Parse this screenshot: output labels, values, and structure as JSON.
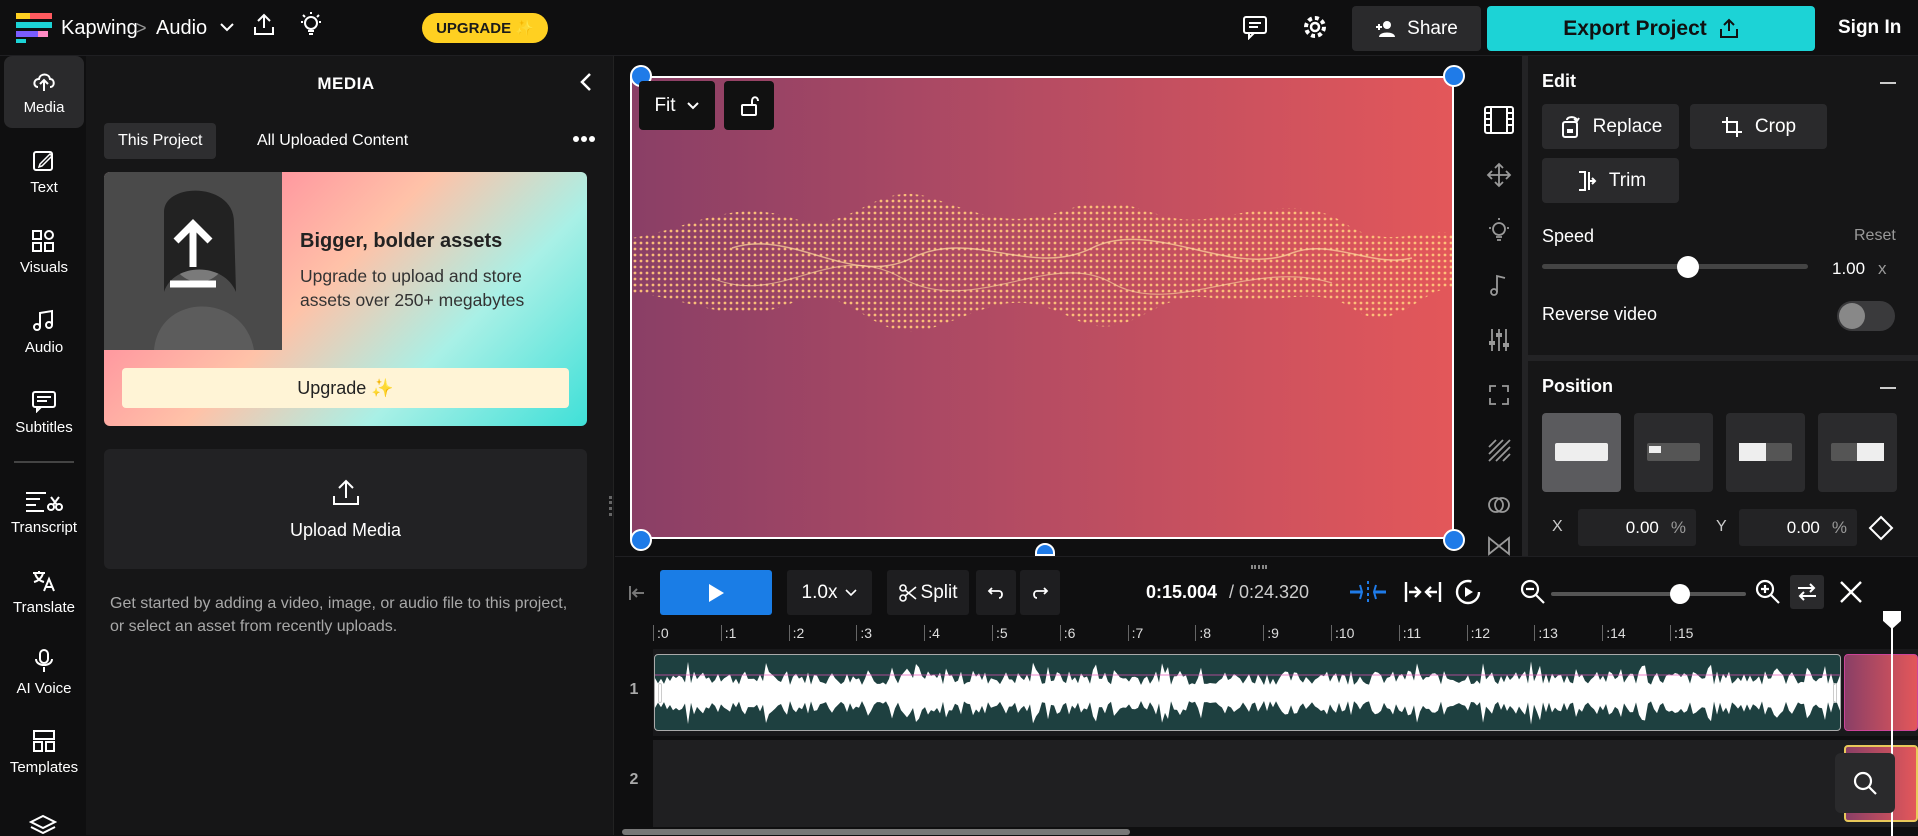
{
  "topbar": {
    "brand": "Kapwing",
    "breadcrumb_sep": ">",
    "project_name": "Audio",
    "upgrade_label": "UPGRADE ✨",
    "share_label": "Share",
    "export_label": "Export Project",
    "signin_label": "Sign In"
  },
  "leftnav": {
    "items": [
      {
        "label": "Media",
        "icon": "upload-cloud-icon"
      },
      {
        "label": "Text",
        "icon": "text-edit-icon"
      },
      {
        "label": "Visuals",
        "icon": "shapes-icon"
      },
      {
        "label": "Audio",
        "icon": "music-note-icon"
      },
      {
        "label": "Subtitles",
        "icon": "subtitles-icon"
      },
      {
        "label": "Transcript",
        "icon": "transcript-icon"
      },
      {
        "label": "Translate",
        "icon": "translate-icon"
      },
      {
        "label": "AI Voice",
        "icon": "microphone-icon"
      },
      {
        "label": "Templates",
        "icon": "templates-icon"
      }
    ]
  },
  "media": {
    "title": "MEDIA",
    "tabs": [
      "This Project",
      "All Uploaded Content"
    ],
    "promo": {
      "title": "Bigger, bolder assets",
      "text": "Upgrade to upload and store assets over 250+ megabytes",
      "button": "Upgrade ✨"
    },
    "upload_label": "Upload Media",
    "help_text": "Get started by adding a video, image, or audio file to this project, or select an asset from recently uploads."
  },
  "canvas": {
    "fit_label": "Fit"
  },
  "edit": {
    "title": "Edit",
    "replace": "Replace",
    "crop": "Crop",
    "trim": "Trim",
    "speed_label": "Speed",
    "reset_label": "Reset",
    "speed_value": "1.00",
    "speed_unit": "x",
    "speed_fraction": 0.55,
    "reverse_label": "Reverse video",
    "reverse_on": false
  },
  "position": {
    "title": "Position",
    "x_label": "X",
    "x_value": "0.00",
    "y_label": "Y",
    "y_value": "0.00",
    "unit": "%"
  },
  "timeline": {
    "speed": "1.0x",
    "split_label": "Split",
    "current_time": "0:15.004",
    "total_time": "/ 0:24.320",
    "zoom_fraction": 0.66,
    "ticks": [
      ":0",
      ":1",
      ":2",
      ":3",
      ":4",
      ":5",
      ":6",
      ":7",
      ":8",
      ":9",
      ":10",
      ":11",
      ":12",
      ":13",
      ":14",
      ":15"
    ],
    "tracks": [
      "1",
      "2"
    ]
  },
  "colors": {
    "accent": "#1cd3d6",
    "play": "#1a7de6",
    "upgrade": "#ffd021",
    "handle": "#1f7be8"
  }
}
